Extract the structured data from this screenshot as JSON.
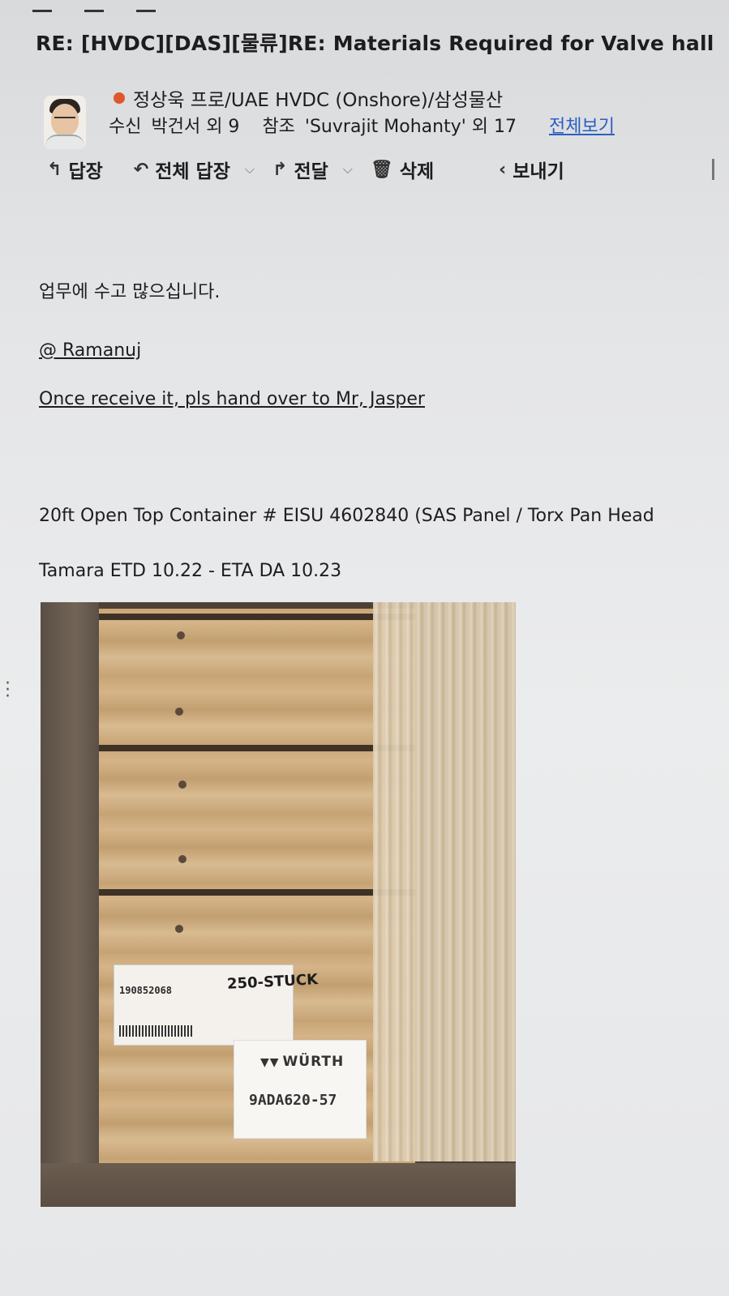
{
  "email": {
    "subject": "RE: [HVDC][DAS][물류]RE: Materials Required for Valve hall",
    "sender": "정상욱 프로/UAE HVDC (Onshore)/삼성물산",
    "to_label": "수신",
    "to_value": "박건서 외 9",
    "cc_label": "참조",
    "cc_value": "'Suvrajit Mohanty' 외 17",
    "view_all": "전체보기"
  },
  "actions": {
    "reply": "답장",
    "reply_all": "전체 답장",
    "forward": "전달",
    "delete": "삭제",
    "share": "보내기"
  },
  "body": {
    "greeting": "업무에 수고 많으십니다.",
    "mention": "@ Ramanuj",
    "instruction": "Once receive it, pls hand over to Mr, Jasper",
    "container": "20ft Open Top Container # EISU 4602840 (SAS Panel / Torx Pan Head",
    "schedule": "Tamara  ETD 10.22 - ETA DA 10.23"
  },
  "photo": {
    "label_number": "190852068",
    "stuck_text": "250-STUCK",
    "brand": "WÜRTH",
    "part_code": "9ADA620-57"
  }
}
